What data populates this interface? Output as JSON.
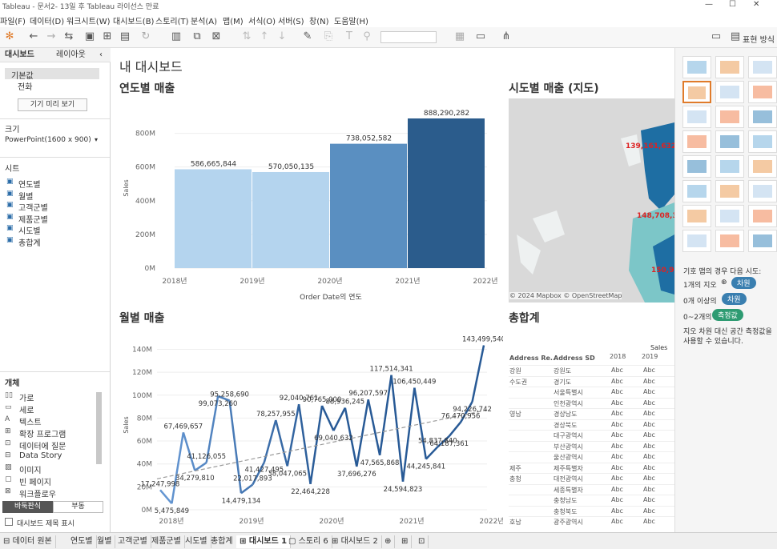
{
  "app": {
    "title": "Tableau - 문서2- 13일 후 Tableau 라이선스 만료"
  },
  "menu": [
    "파일(F)",
    "데이터(D)",
    "워크시트(W)",
    "대시보드(B)",
    "스토리(T)",
    "분석(A)",
    "맵(M)",
    "서식(O)",
    "서버(S)",
    "창(N)",
    "도움말(H)"
  ],
  "toolbar": {
    "show_me": "표현 방식"
  },
  "left": {
    "tab_dashboard": "대시보드",
    "tab_layout": "레이아웃",
    "devices": [
      "기본값",
      "전화"
    ],
    "preview_button": "기기 미리 보기",
    "size_label": "크기",
    "size_value": "PowerPoint(1600 x 900)",
    "sheets_label": "시트",
    "sheets": [
      "연도별",
      "월별",
      "고객군별",
      "제품군별",
      "시도별",
      "총합계"
    ],
    "objects_label": "개체",
    "objects": [
      "가로",
      "세로",
      "텍스트",
      "확장 프로그램",
      "데이터에 질문",
      "Data Story",
      "이미지",
      "빈 페이지",
      "워크플로우"
    ],
    "tile_label": "바둑판식",
    "float_label": "부동",
    "show_title": "대시보드 제목 표시"
  },
  "dashboard": {
    "title": "내 대시보드"
  },
  "chart_data": [
    {
      "type": "bar",
      "title": "연도별 매출",
      "xlabel": "Order Date의 연도",
      "ylabel": "Sales",
      "categories": [
        "2018년",
        "2019년",
        "2020년",
        "2021년",
        "2022년"
      ],
      "values": [
        586665844,
        570050135,
        738052582,
        888290282
      ],
      "value_labels": [
        "586,665,844",
        "570,050,135",
        "738,052,582",
        "888,290,282"
      ],
      "yticks": [
        "0M",
        "200M",
        "400M",
        "600M",
        "800M"
      ],
      "ylim": [
        0,
        950000000
      ],
      "colors": [
        "#b4d4ee",
        "#b4d4ee",
        "#5a8fc1",
        "#2b5c8c"
      ]
    },
    {
      "type": "line",
      "title": "월별 매출",
      "ylabel": "Sales",
      "xticks": [
        "2018년",
        "2019년",
        "2020년",
        "2021년",
        "2022년"
      ],
      "yticks": [
        "0M",
        "20M",
        "40M",
        "60M",
        "80M",
        "100M",
        "120M",
        "140M"
      ],
      "ylim": [
        0,
        148000000
      ],
      "values": [
        17247998,
        5475849,
        67469657,
        34279810,
        41126055,
        99073260,
        95258690,
        14479134,
        22017893,
        41427495,
        78257955,
        38047065,
        92040761,
        22464228,
        90765000,
        69040632,
        88936245,
        37696276,
        96207597,
        47565868,
        117514341,
        24594823,
        106450449,
        44245841,
        54837840,
        64187361,
        76470956,
        94226742,
        143499540
      ],
      "labels": [
        "17,247,998",
        "5,475,849",
        "67,469,657",
        "34,279,810",
        "41,126,055",
        "99,073,260",
        "95,258,690",
        "14,479,134",
        "22,017,893",
        "41,427,495",
        "78,257,955",
        "38,047,065",
        "92,040,761",
        "22,464,228",
        "90,765,000",
        "69,040,632",
        "88,936,245",
        "37,696,276",
        "96,207,597",
        "47,565,868",
        "117,514,341",
        "24,594,823",
        "106,450,449",
        "44,245,841",
        "54,837,840",
        "64,187,361",
        "76,470,956",
        "94,226,742",
        "143,499,540"
      ]
    }
  ],
  "map": {
    "title": "시도별 매출 (지도)",
    "labels": [
      "139,161,632",
      "148,708,3",
      "150,9"
    ],
    "attribution": "© 2024 Mapbox © OpenStreetMap"
  },
  "table": {
    "title": "총합계",
    "measure": "Sales",
    "col_region": "Address Re..",
    "col_sd": "Address SD",
    "years": [
      "2018",
      "2019"
    ],
    "rows": [
      [
        "강원",
        "강원도"
      ],
      [
        "수도권",
        "경기도"
      ],
      [
        "",
        "서울특별시"
      ],
      [
        "",
        "인천광역시"
      ],
      [
        "영남",
        "경상남도"
      ],
      [
        "",
        "경상북도"
      ],
      [
        "",
        "대구광역시"
      ],
      [
        "",
        "부산광역시"
      ],
      [
        "",
        "울산광역시"
      ],
      [
        "제주",
        "제주특별자"
      ],
      [
        "충청",
        "대전광역시"
      ],
      [
        "",
        "세종특별자"
      ],
      [
        "",
        "충청남도"
      ],
      [
        "",
        "충청북도"
      ],
      [
        "호남",
        "광주광역시"
      ]
    ],
    "cell": "Abc"
  },
  "showme": {
    "hint_title": "기호 맵의 경우 다음 시도:",
    "req1": "1개의 지오",
    "req1_pill": "차원",
    "req2": "0개 이상의",
    "req2_pill": "차원",
    "req3": "0~2개의",
    "req3_pill": "측정값",
    "note": "지오 차원 대신 공간 측정값을 사용할 수 있습니다."
  },
  "bottom": {
    "datasource": "데이터 원본",
    "tabs": [
      "연도별",
      "월별",
      "고객군별",
      "제품군별",
      "시도별",
      "총합계",
      "대시보드 1",
      "스토리 6",
      "대시보드 2"
    ]
  }
}
